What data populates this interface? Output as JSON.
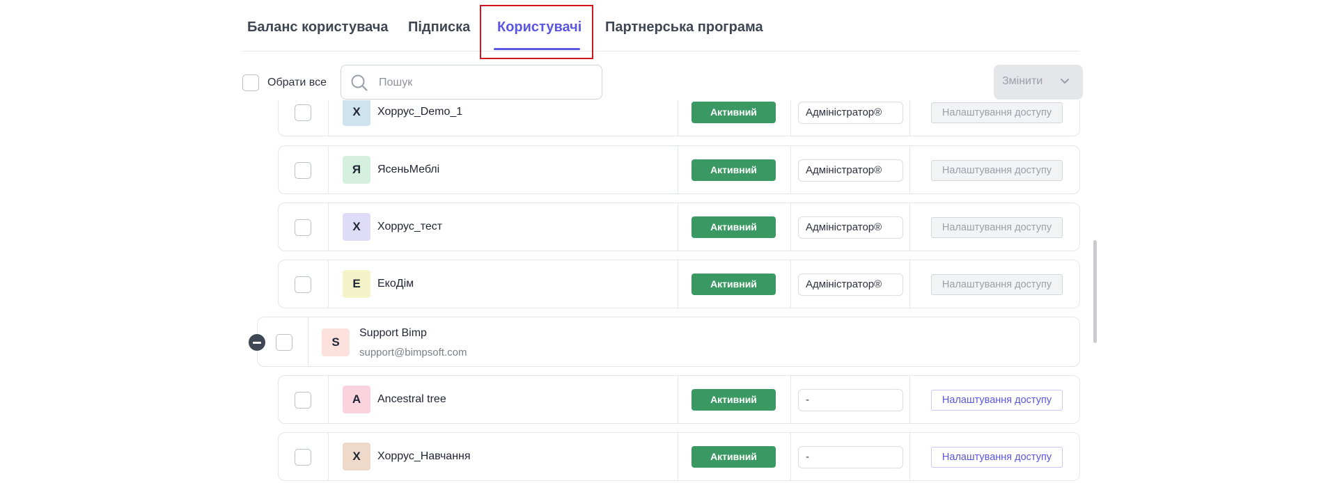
{
  "tabs": [
    {
      "label": "Баланс користувача"
    },
    {
      "label": "Підписка"
    },
    {
      "label": "Користувачі"
    },
    {
      "label": "Партнерська програма"
    }
  ],
  "toolbar": {
    "select_all_label": "Обрати все",
    "search_placeholder": "Пошук",
    "change_label": "Змінити"
  },
  "rows": [
    {
      "avatar_letter": "Х",
      "avatar_color": "#cfe3ef",
      "name": "Хоррус_Demo_1",
      "status": "Активний",
      "role": "Адміністратор®",
      "access": "Налаштування доступу",
      "access_enabled": false
    },
    {
      "avatar_letter": "Я",
      "avatar_color": "#d5efdf",
      "name": "ЯсеньМеблі",
      "status": "Активний",
      "role": "Адміністратор®",
      "access": "Налаштування доступу",
      "access_enabled": false
    },
    {
      "avatar_letter": "Х",
      "avatar_color": "#dedcf7",
      "name": "Хоррус_тест",
      "status": "Активний",
      "role": "Адміністратор®",
      "access": "Налаштування доступу",
      "access_enabled": false
    },
    {
      "avatar_letter": "Е",
      "avatar_color": "#f3f2c8",
      "name": "ЕкоДім",
      "status": "Активний",
      "role": "Адміністратор®",
      "access": "Налаштування доступу",
      "access_enabled": false
    }
  ],
  "group": {
    "avatar_letter": "S",
    "avatar_color": "#fde1dc",
    "name": "Support Bimp",
    "email": "support@bimpsoft.com"
  },
  "sub_rows": [
    {
      "avatar_letter": "A",
      "avatar_color": "#fbd3df",
      "name": "Ancestral tree",
      "status": "Активний",
      "role": "-",
      "access": "Налаштування доступу",
      "access_enabled": true
    },
    {
      "avatar_letter": "Х",
      "avatar_color": "#efd9c8",
      "name": "Хоррус_Навчання",
      "status": "Активний",
      "role": "-",
      "access": "Налаштування доступу",
      "access_enabled": true
    }
  ],
  "colors": {
    "accent": "#5a56e0",
    "status_active": "#3a9863",
    "highlight_box": "#d0161d"
  }
}
